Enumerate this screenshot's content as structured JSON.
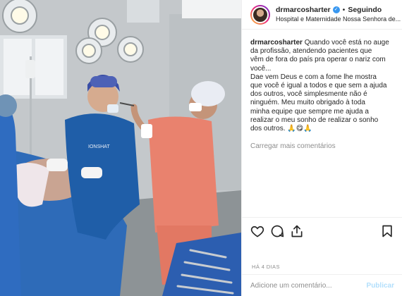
{
  "post": {
    "username": "drmarcosharter",
    "verified_icon": "verified-badge-icon",
    "separator": "•",
    "follow_status": "Seguindo",
    "location": "Hospital e Maternidade Nossa Senhora de...",
    "caption_user": "drmarcosharter",
    "caption_lines": [
      "Quando você está no auge",
      "da profissão, atendendo pacientes que",
      "vêm de fora do país pra operar o nariz com",
      "você...",
      "Dae vem Deus e com a fome lhe mostra",
      "que você é igual a todos e que sem a ajuda",
      "dos outros, você simplesmente não é",
      "ninguém. Meu muito obrigado à toda",
      "minha equipe que sempre me ajuda a",
      "realizar o meu sonho de realizar o sonho",
      "dos outros. 🙏😋🙏"
    ],
    "load_more": "Carregar mais comentários",
    "timestamp": "HÁ 4 DIAS"
  },
  "actions": {
    "like_icon": "heart-icon",
    "comment_icon": "comment-icon",
    "share_icon": "share-icon",
    "save_icon": "bookmark-icon"
  },
  "comment_box": {
    "placeholder": "Adicione um comentário...",
    "publish_label": "Publicar"
  },
  "photo": {
    "scrub_logo_text": "IONSHAT"
  },
  "colors": {
    "accent_blue": "#3897f0",
    "muted": "#8e8e8e",
    "publish_disabled": "#b2dffc",
    "scrub_blue": "#1f5ea8",
    "scrub_pink": "#e9826e"
  }
}
